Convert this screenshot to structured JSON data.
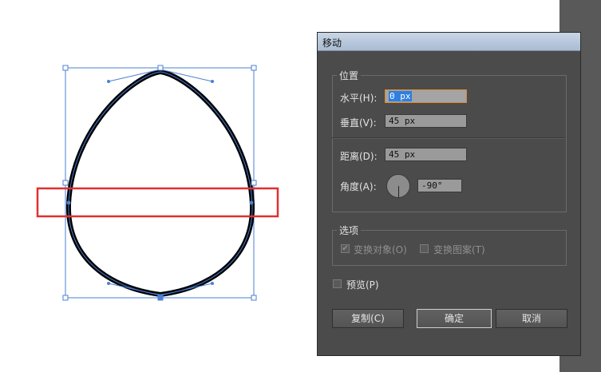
{
  "dialog": {
    "title": "移动",
    "position_group": {
      "legend": "位置",
      "horizontal_label": "水平(H):",
      "horizontal_value": "0 px",
      "vertical_label": "垂直(V):",
      "vertical_value": "45 px",
      "distance_label": "距离(D):",
      "distance_value": "45 px",
      "angle_label": "角度(A):",
      "angle_value": "-90°"
    },
    "options_group": {
      "legend": "选项",
      "transform_objects_label": "变换对象(O)",
      "transform_objects_checked": true,
      "transform_patterns_label": "变换图案(T)",
      "transform_patterns_checked": false
    },
    "preview_label": "预览(P)",
    "preview_checked": false,
    "copy_button": "复制(C)",
    "ok_button": "确定",
    "cancel_button": "取消"
  },
  "colors": {
    "selection_blue": "#4a7fd4",
    "highlight_red": "#e03030",
    "dialog_bg": "#4b4b4b",
    "focus_orange": "#e08a2a"
  }
}
